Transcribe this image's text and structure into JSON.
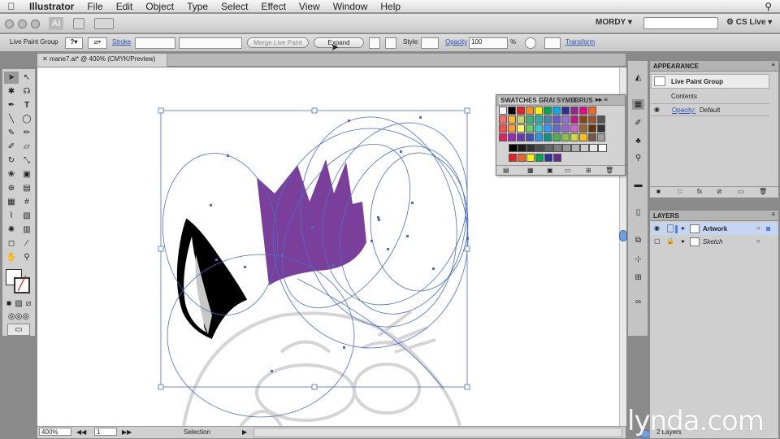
{
  "menubar": {
    "app": "Illustrator",
    "items": [
      "File",
      "Edit",
      "Object",
      "Type",
      "Select",
      "Effect",
      "View",
      "Window",
      "Help"
    ]
  },
  "appbar": {
    "logo": "Ai",
    "workspace": "MORDY",
    "search_placeholder": "",
    "cslive": "CS Live"
  },
  "controlbar": {
    "object_type": "Live Paint Group",
    "stroke_label": "Stroke",
    "merge_button": "Merge Live Paint",
    "expand_button": "Expand",
    "style_label": "Style:",
    "opacity_label": "Opacity",
    "opacity_value": "100",
    "opacity_unit": "%",
    "transform_label": "Transform"
  },
  "document": {
    "tab_title": "mane7.ai* @ 400% (CMYK/Preview)"
  },
  "status": {
    "zoom": "400%",
    "artboard": "1",
    "mode": "Selection"
  },
  "swatches_panel": {
    "tabs": [
      "SWATCHES",
      "GRAI",
      "SYMB",
      "BRUS"
    ],
    "colors_row1": [
      "#ffffff",
      "#000000",
      "#ee1c24",
      "#f7941d",
      "#fff200",
      "#00a651",
      "#00aeef",
      "#2e3192",
      "#92278f",
      "#ec008c",
      "#f26522"
    ],
    "colors_row2": [
      "#ff6b6b",
      "#f7b733",
      "#c5d86d",
      "#3cb371",
      "#20b2aa",
      "#4682b4",
      "#6a5acd",
      "#9370db",
      "#c71585",
      "#8b4513",
      "#a0522d",
      "#555555"
    ],
    "colors_row3": [
      "#ff4d4d",
      "#ff9933",
      "#ffff66",
      "#66cc66",
      "#33cccc",
      "#3399ff",
      "#6666cc",
      "#9966cc",
      "#cc66cc",
      "#996633",
      "#663300",
      "#333333"
    ],
    "colors_row4": [
      "#e91e63",
      "#9c27b0",
      "#673ab7",
      "#3f51b5",
      "#2196f3",
      "#009688",
      "#4caf50",
      "#8bc34a",
      "#cddc39",
      "#ffc107",
      "#795548",
      "#9e9e9e"
    ],
    "grays": [
      "#000000",
      "#1a1a1a",
      "#333333",
      "#4d4d4d",
      "#666666",
      "#808080",
      "#999999",
      "#b3b3b3",
      "#cccccc",
      "#e6e6e6",
      "#ffffff"
    ],
    "group": [
      "#ee1c24",
      "#f26522",
      "#fff200",
      "#00a651",
      "#2e3192",
      "#662d91"
    ]
  },
  "appearance_panel": {
    "title": "APPEARANCE",
    "object": "Live Paint Group",
    "contents": "Contents",
    "opacity_label": "Opacity:",
    "opacity_value": "Default"
  },
  "layers_panel": {
    "title": "LAYERS",
    "layers": [
      {
        "name": "Artwork",
        "color": "#4f7fe0"
      },
      {
        "name": "Sketch",
        "color": "#a0a0a0"
      }
    ],
    "count": "2 Layers"
  },
  "watermark": "lynda.com",
  "accent": "#3d6fb3",
  "selection_color": "#4a6fc4",
  "fill_purple": "#7a3f9a"
}
